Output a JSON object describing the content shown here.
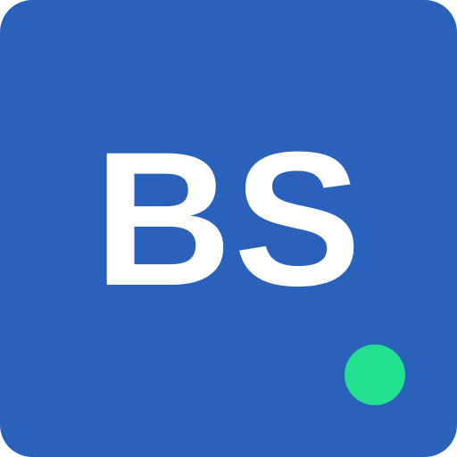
{
  "logo": {
    "monogram": "BS",
    "background_color": "#2a62bb",
    "text_color": "#ffffff"
  },
  "status_indicator": {
    "icon": "online-dot-icon",
    "color": "#21e08f"
  }
}
